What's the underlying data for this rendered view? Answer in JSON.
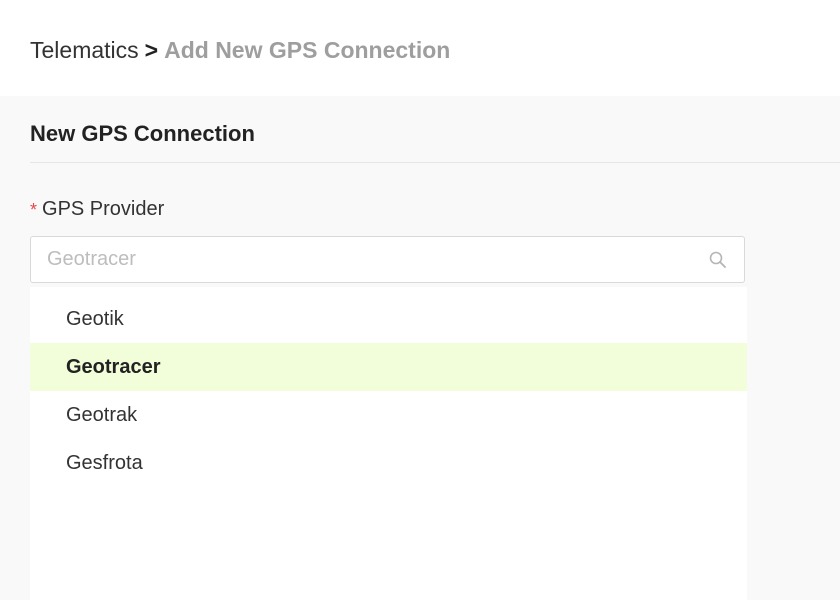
{
  "breadcrumb": {
    "root": "Telematics",
    "separator": ">",
    "current": "Add New GPS Connection"
  },
  "form": {
    "title": "New GPS Connection",
    "provider": {
      "required_mark": "*",
      "label": "GPS Provider",
      "placeholder": "Geotracer",
      "icon": "search-icon"
    }
  },
  "dropdown": {
    "options": [
      {
        "label": "Geotik",
        "selected": false
      },
      {
        "label": "Geotracer",
        "selected": true
      },
      {
        "label": "Geotrak",
        "selected": false
      },
      {
        "label": "Gesfrota",
        "selected": false
      }
    ]
  },
  "colors": {
    "accent_highlight": "#f2fdd9",
    "required": "#e5484d",
    "muted_text": "#9e9e9e"
  }
}
